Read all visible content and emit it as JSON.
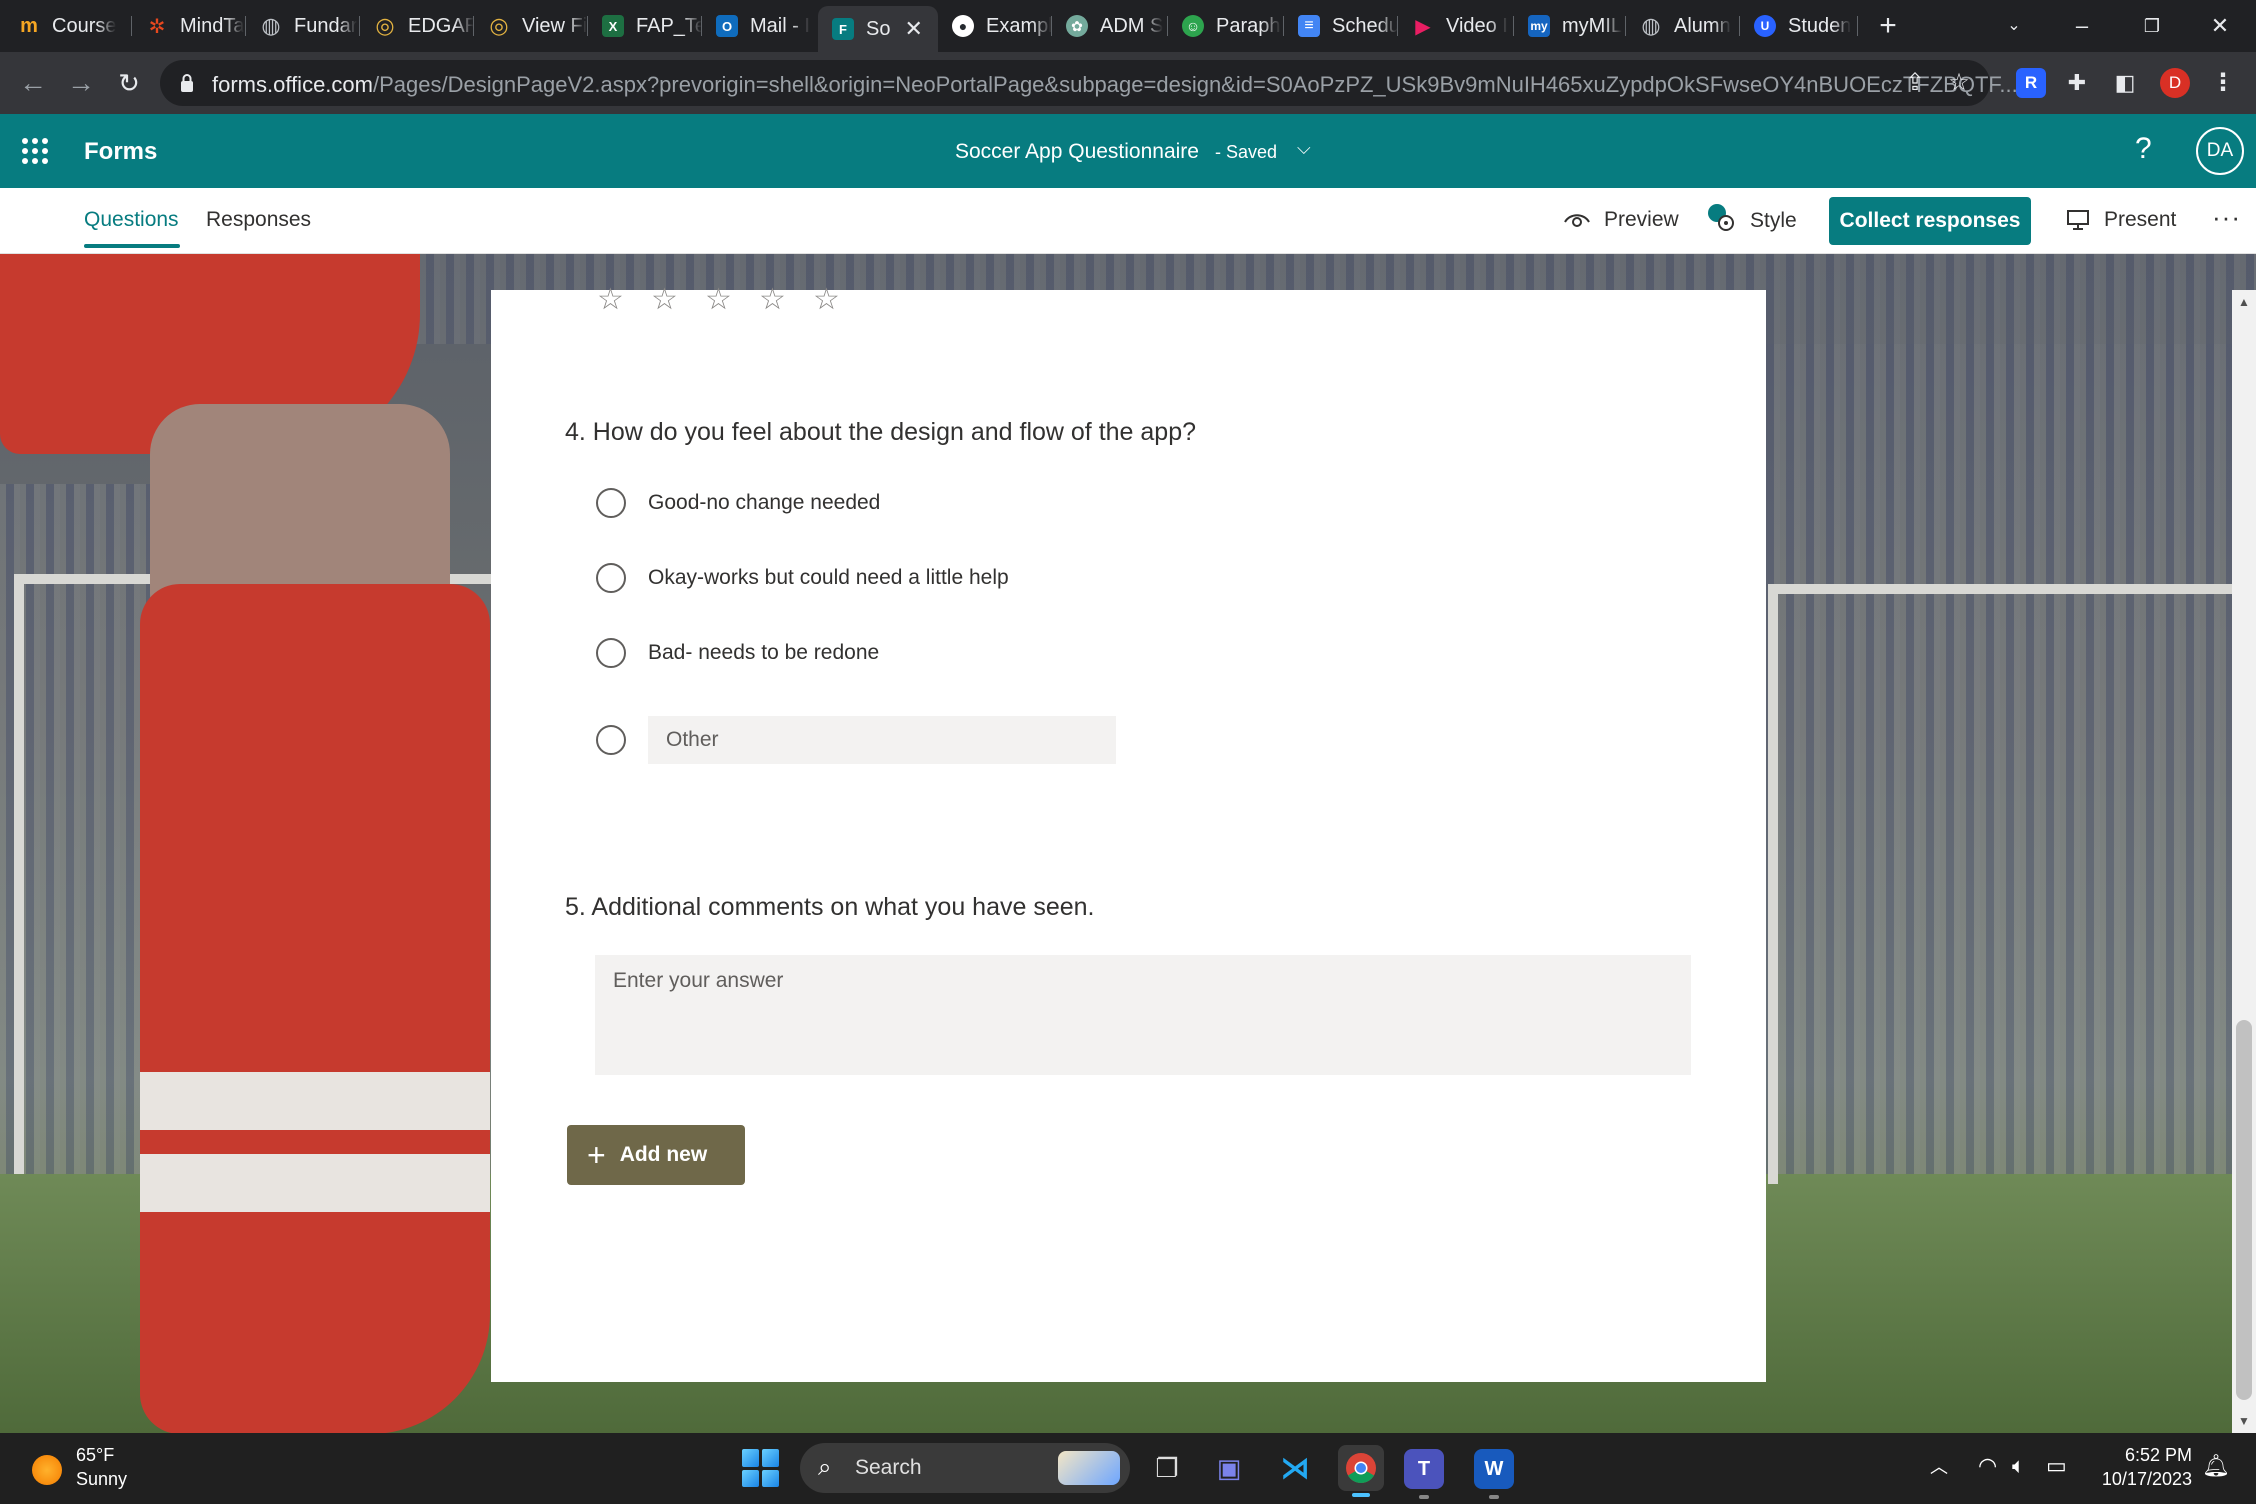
{
  "browser": {
    "tabs": [
      {
        "label": "Course",
        "icon": "coursera-icon",
        "color": "#0056d2",
        "glyph": "m"
      },
      {
        "label": "MindTa",
        "icon": "mindtap-icon",
        "color": "#e8481e",
        "glyph": "✲"
      },
      {
        "label": "Fundar",
        "icon": "globe-icon",
        "color": "#5f6368",
        "glyph": "◍"
      },
      {
        "label": "EDGAR",
        "icon": "sec-seal-icon",
        "color": "#b88a1b",
        "glyph": "◎"
      },
      {
        "label": "View Fi",
        "icon": "sec-seal-icon",
        "color": "#b88a1b",
        "glyph": "◎"
      },
      {
        "label": "FAP_Te",
        "icon": "excel-icon",
        "color": "#1d6f42",
        "glyph": "X"
      },
      {
        "label": "Mail - I",
        "icon": "outlook-icon",
        "color": "#0f6cbd",
        "glyph": "O"
      },
      {
        "label": "So",
        "icon": "forms-icon",
        "color": "#077c80",
        "glyph": "F",
        "active": true
      },
      {
        "label": "Exampl",
        "icon": "github-icon",
        "color": "#24292f",
        "glyph": "●"
      },
      {
        "label": "ADM S",
        "icon": "chatgpt-icon",
        "color": "#74aa9c",
        "glyph": "✿"
      },
      {
        "label": "Paraph",
        "icon": "paraphraser-icon",
        "color": "#2da44e",
        "glyph": "☺"
      },
      {
        "label": "Schedu",
        "icon": "docs-icon",
        "color": "#4285f4",
        "glyph": "≡"
      },
      {
        "label": "Video I",
        "icon": "play-icon",
        "color": "#e91e63",
        "glyph": "▶"
      },
      {
        "label": "myMIL",
        "icon": "mymil-icon",
        "color": "#1565c0",
        "glyph": "my"
      },
      {
        "label": "Alumn",
        "icon": "globe-icon",
        "color": "#5f6368",
        "glyph": "◍"
      },
      {
        "label": "Studen",
        "icon": "student-icon",
        "color": "#2962ff",
        "glyph": "U"
      }
    ],
    "url_host": "forms.office.com",
    "url_path": "/Pages/DesignPageV2.aspx?prevorigin=shell&origin=NeoPortalPage&subpage=design&id=S0AoPzPZ_USk9Bv9mNuIH465xuZypdpOkSFwseOY4nBUOEczTFZBQTF...",
    "profile_initial": "D"
  },
  "forms_header": {
    "app_name": "Forms",
    "form_title": "Soccer App Questionnaire",
    "saved_status": "-  Saved",
    "help": "?",
    "avatar": "DA"
  },
  "toolbar": {
    "tab_questions": "Questions",
    "tab_responses": "Responses",
    "preview": "Preview",
    "style": "Style",
    "collect": "Collect responses",
    "present": "Present",
    "more": "···"
  },
  "form": {
    "stars": [
      "☆",
      "☆",
      "☆",
      "☆",
      "☆"
    ],
    "q4": {
      "title": "4. How do you feel about the design and flow of the app?",
      "options": [
        "Good-no change needed",
        "Okay-works but could need a little help",
        "Bad- needs to be redone"
      ],
      "other_placeholder": "Other"
    },
    "q5": {
      "title": "5. Additional comments on what you have seen.",
      "placeholder": "Enter your answer"
    },
    "add_new": "Add new"
  },
  "taskbar": {
    "weather_temp": "65°F",
    "weather_desc": "Sunny",
    "search_label": "Search",
    "time": "6:52 PM",
    "date": "10/17/2023"
  },
  "colors": {
    "forms_teal": "#077c80",
    "add_new_bg": "#6f6849"
  }
}
